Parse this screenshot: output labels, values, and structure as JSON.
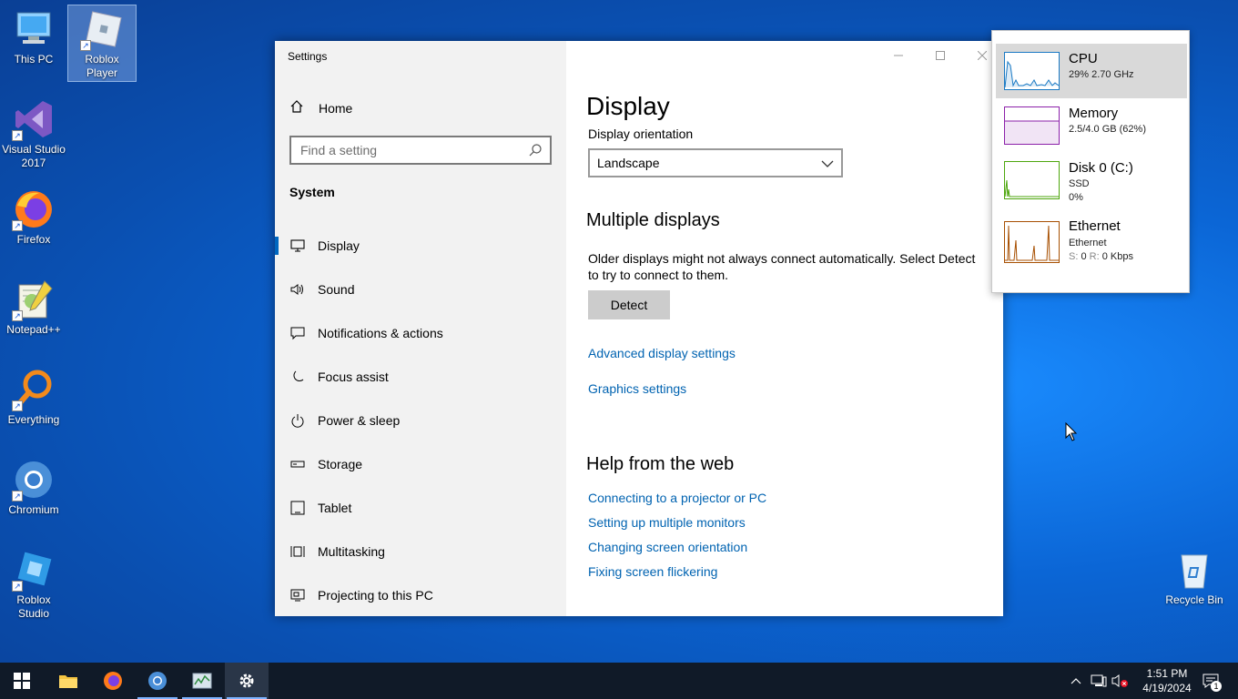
{
  "desktop": {
    "icons": [
      {
        "label": "This PC"
      },
      {
        "label": "Roblox Player"
      },
      {
        "label": "Visual Studio 2017"
      },
      {
        "label": "Firefox"
      },
      {
        "label": "Notepad++"
      },
      {
        "label": "Everything"
      },
      {
        "label": "Chromium"
      },
      {
        "label": "Roblox Studio"
      },
      {
        "label": "Recycle Bin"
      }
    ]
  },
  "window": {
    "title": "Settings",
    "sidebar": {
      "home": "Home",
      "search_placeholder": "Find a setting",
      "section": "System",
      "items": [
        {
          "label": "Display",
          "icon": "monitor-icon"
        },
        {
          "label": "Sound",
          "icon": "speaker-icon"
        },
        {
          "label": "Notifications & actions",
          "icon": "notification-icon"
        },
        {
          "label": "Focus assist",
          "icon": "moon-icon"
        },
        {
          "label": "Power & sleep",
          "icon": "power-icon"
        },
        {
          "label": "Storage",
          "icon": "storage-icon"
        },
        {
          "label": "Tablet",
          "icon": "tablet-icon"
        },
        {
          "label": "Multitasking",
          "icon": "multitasking-icon"
        },
        {
          "label": "Projecting to this PC",
          "icon": "projecting-icon"
        }
      ]
    },
    "content": {
      "title": "Display",
      "orientation_label": "Display orientation",
      "orientation_value": "Landscape",
      "multiple_displays": "Multiple displays",
      "description": "Older displays might not always connect automatically. Select Detect to try to connect to them.",
      "detect_button": "Detect",
      "advanced_link": "Advanced display settings",
      "graphics_link": "Graphics settings",
      "help_title": "Help from the web",
      "help_links": [
        "Connecting to a projector or PC",
        "Setting up multiple monitors",
        "Changing screen orientation",
        "Fixing screen flickering"
      ]
    }
  },
  "performance": {
    "cpu": {
      "name": "CPU",
      "detail": "29%  2.70 GHz",
      "color": "#1979c4"
    },
    "memory": {
      "name": "Memory",
      "detail": "2.5/4.0 GB (62%)",
      "color": "#8b1fa9"
    },
    "disk": {
      "name": "Disk 0 (C:)",
      "type": "SSD",
      "usage": "0%",
      "color": "#4da60c"
    },
    "ethernet": {
      "name": "Ethernet",
      "adapter": "Ethernet",
      "send_label": "S:",
      "send_value": "0",
      "recv_label": "R:",
      "recv_value": "0 Kbps",
      "color": "#a74f01"
    }
  },
  "taskbar": {
    "time": "1:51 PM",
    "date": "4/19/2024",
    "notification_count": "1"
  }
}
